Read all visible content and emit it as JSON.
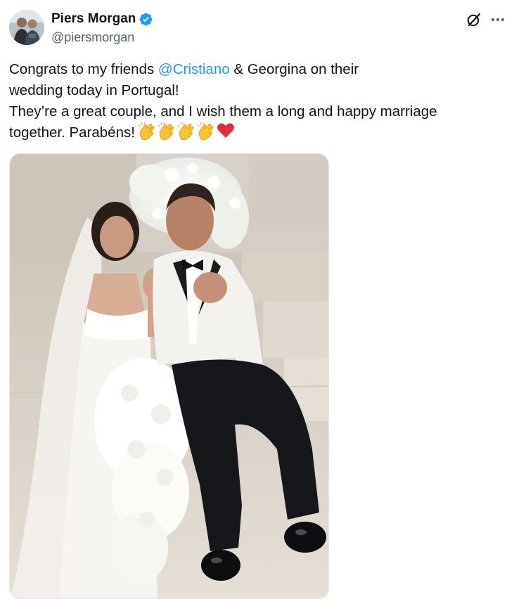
{
  "author": {
    "display_name": "Piers Morgan",
    "handle": "@piersmorgan",
    "verified": true,
    "verified_color": "#1d9bf0"
  },
  "actions": {
    "grok_icon": "grok-icon",
    "more_icon": "more-horizontal-icon"
  },
  "tweet": {
    "line1_before": "Congrats to my friends ",
    "mention": "@Cristiano",
    "line1_after": " & Georgina on their",
    "line2": "wedding today in Portugal!",
    "line3": "They’re a great couple, and I wish them a long and happy marriage",
    "line4": "together. Parabéns!",
    "emojis": [
      "clapping-hands",
      "clapping-hands",
      "clapping-hands",
      "clapping-hands",
      "red-heart"
    ],
    "mention_color": "#1d9bf0"
  },
  "media": {
    "type": "photo",
    "icon": "wedding-photo"
  }
}
